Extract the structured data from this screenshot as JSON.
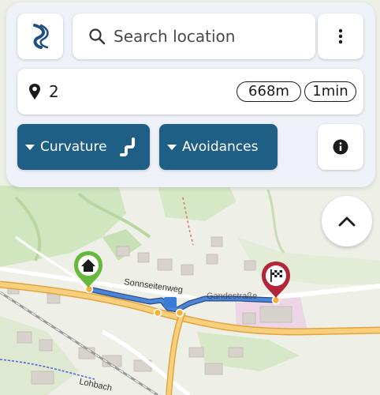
{
  "search": {
    "placeholder": "Search location",
    "icon": "search-icon"
  },
  "route": {
    "waypoint_count": "2",
    "distance": "668m",
    "duration": "1min"
  },
  "toolbar": {
    "curvature_label": "Curvature",
    "avoidances_label": "Avoidances"
  },
  "map": {
    "streets": [
      "Sonnseitenweg",
      "Gandestraße",
      "Lohbach"
    ],
    "start_marker": "home-icon",
    "end_marker": "finish-flag-icon"
  },
  "colors": {
    "primary": "#1f5f86",
    "route": "#4b86d6",
    "start": "#67b83c",
    "end": "#b3263a",
    "road": "#f4c26a"
  }
}
